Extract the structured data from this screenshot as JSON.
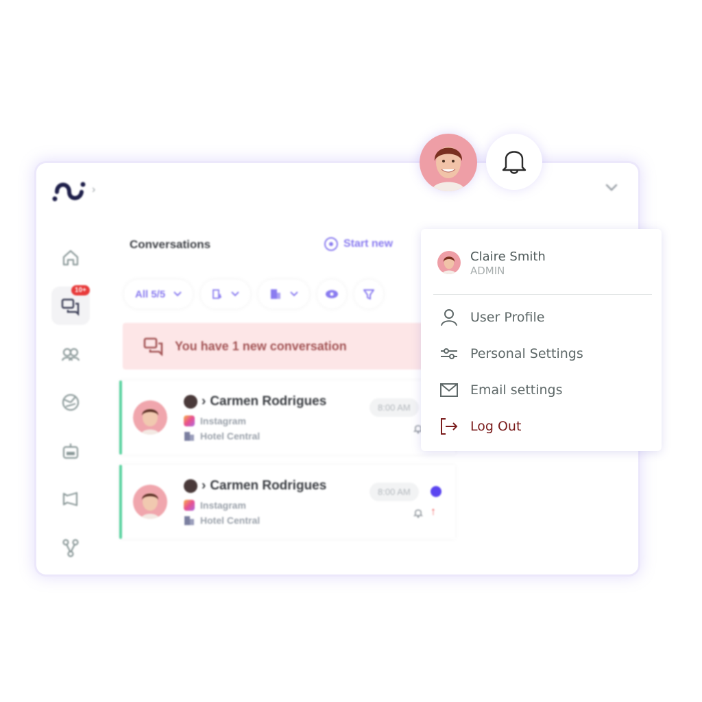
{
  "app": {
    "logo_alt": "app-logo",
    "sidebar": {
      "items": [
        {
          "id": "home",
          "icon": "home-icon"
        },
        {
          "id": "conversations",
          "icon": "chat-icon",
          "badge": "10+",
          "active": true
        },
        {
          "id": "contacts",
          "icon": "users-icon"
        },
        {
          "id": "analytics",
          "icon": "chart-pie-icon"
        },
        {
          "id": "bots",
          "icon": "robot-icon"
        },
        {
          "id": "campaigns",
          "icon": "megaphone-icon"
        },
        {
          "id": "integrations",
          "icon": "flow-icon"
        }
      ]
    },
    "conversations": {
      "title": "Conversations",
      "start_new_label": "Start new",
      "filters": [
        {
          "label": "All 5/5",
          "has_dropdown": true
        },
        {
          "label": "",
          "icon": "sort-icon",
          "has_dropdown": true
        },
        {
          "label": "",
          "icon": "building-icon",
          "has_dropdown": true
        },
        {
          "label": "",
          "icon": "eye-icon",
          "has_dropdown": false
        },
        {
          "label": "",
          "icon": "filter-icon",
          "has_dropdown": false
        }
      ],
      "banner": {
        "text": "You have 1 new conversation",
        "color": "#fde6e7"
      },
      "items": [
        {
          "name": "Carmen Rodrigues",
          "channel": "Instagram",
          "property": "Hotel Central",
          "time": "8:00 AM",
          "unread": false
        },
        {
          "name": "Carmen Rodrigues",
          "channel": "Instagram",
          "property": "Hotel Central",
          "time": "8:00 AM",
          "unread": true
        }
      ]
    }
  },
  "user_menu": {
    "name": "Claire Smith",
    "role": "ADMIN",
    "items": [
      {
        "label": "User Profile",
        "icon": "user-icon"
      },
      {
        "label": "Personal Settings",
        "icon": "sliders-icon"
      },
      {
        "label": "Email settings",
        "icon": "mail-icon"
      },
      {
        "label": "Log Out",
        "icon": "logout-icon"
      }
    ]
  },
  "colors": {
    "accent": "#8a7cf0",
    "unread": "#5b45f0",
    "active_bar": "#5ad3a0",
    "badge": "#e83a3a",
    "logout": "#7a1c1c"
  }
}
